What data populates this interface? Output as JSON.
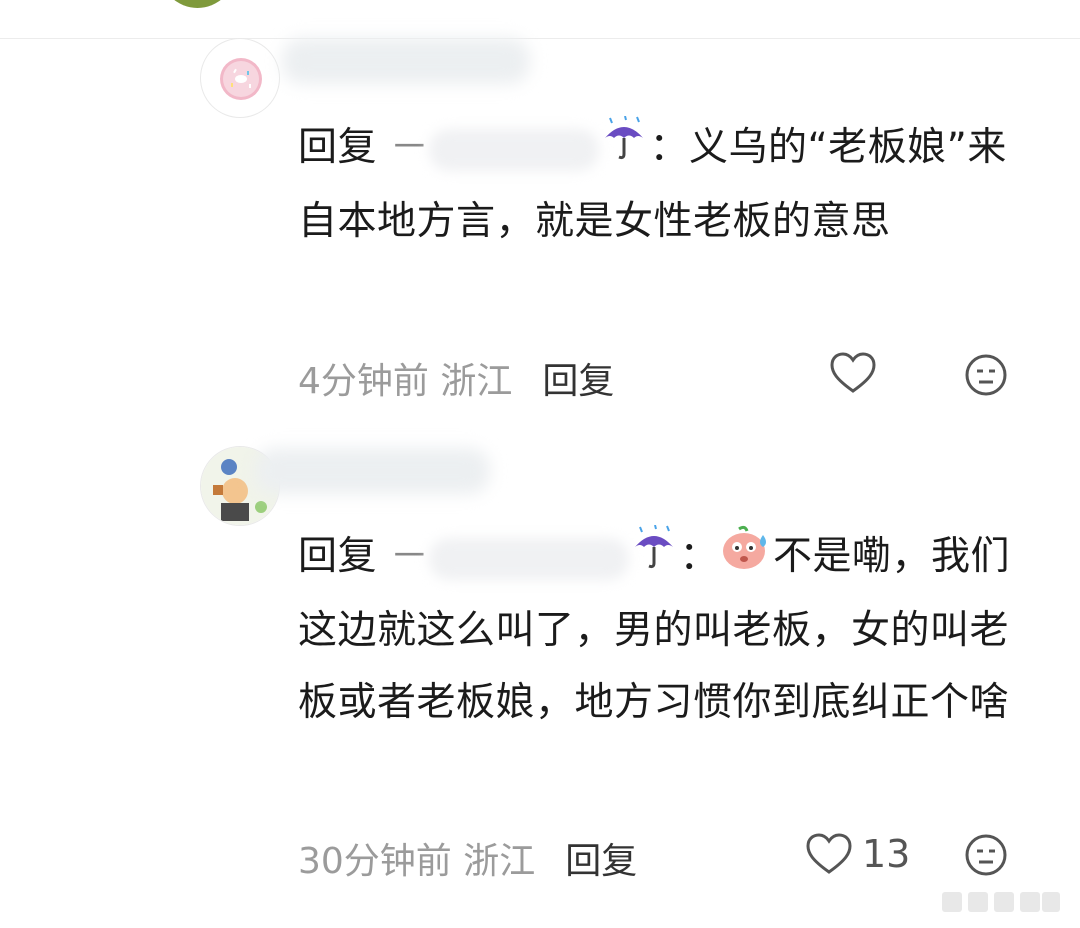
{
  "comments": [
    {
      "reply_prefix": "回复",
      "reply_dash": "－",
      "reply_colon": "：",
      "reply_body": "义乌的“老板娘”来自本地方言，就是女性老板的意思",
      "time": "4分钟前",
      "location": "浙江",
      "reply_label": "回复",
      "like_count": ""
    },
    {
      "reply_prefix": "回复",
      "reply_dash": "－",
      "reply_colon": "：",
      "reply_body": "不是嘞，我们这边就这么叫了，男的叫老板，女的叫老板或者老板娘，地方习惯你到底纠正个啥",
      "time": "30分钟前",
      "location": "浙江",
      "reply_label": "回复",
      "like_count": "13"
    }
  ],
  "icons": {
    "heart": "heart-outline-icon",
    "react": "neutral-face-icon",
    "umbrella": "umbrella-rain-emoji",
    "sweat": "sweat-face-emoji"
  },
  "colors": {
    "meta": "#9b9b9b",
    "text": "#1b1b1b",
    "umbrella": "#6a4cc2"
  }
}
